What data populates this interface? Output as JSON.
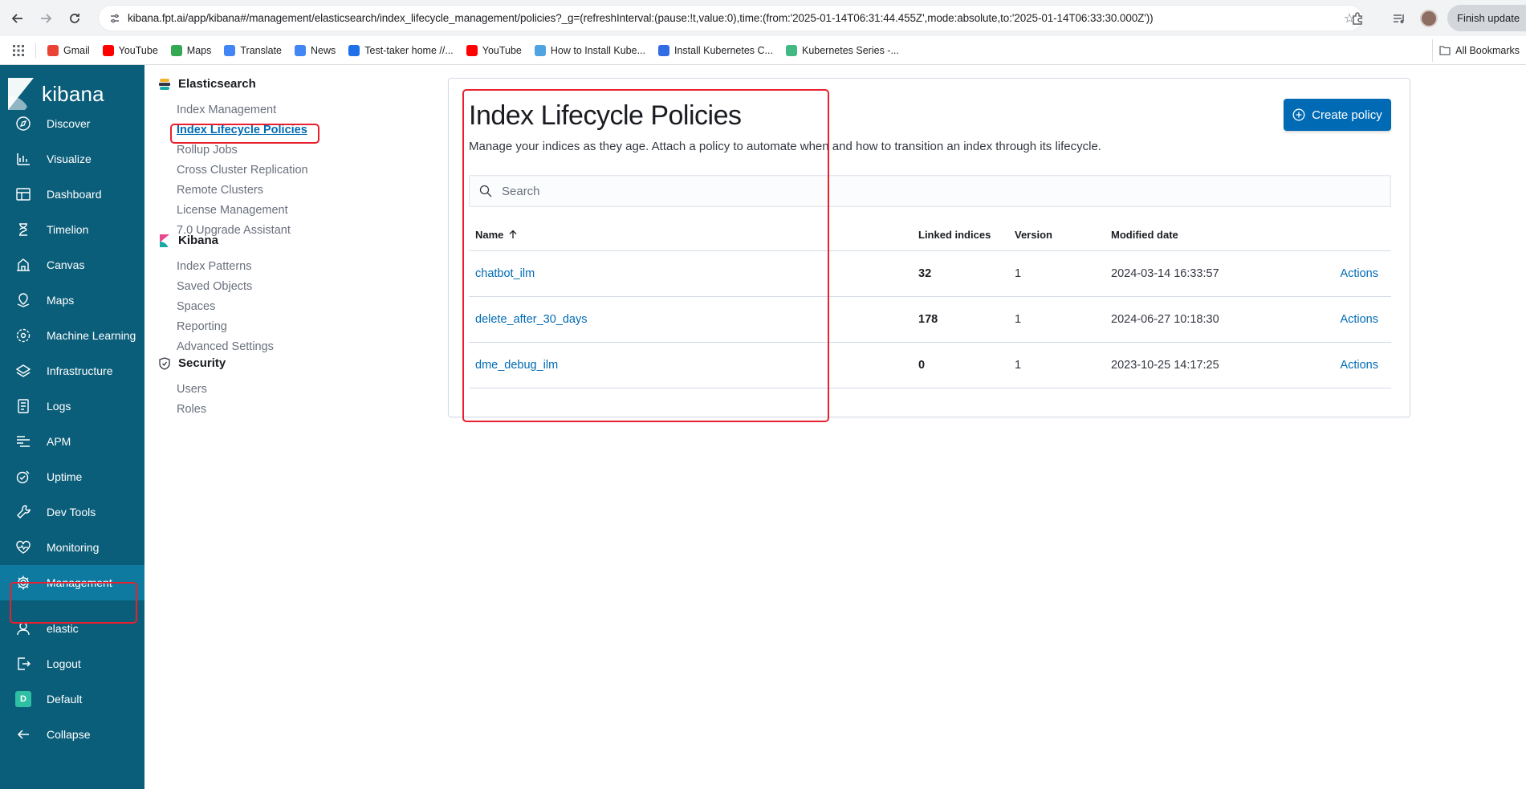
{
  "browser": {
    "url": "kibana.fpt.ai/app/kibana#/management/elasticsearch/index_lifecycle_management/policies?_g=(refreshInterval:(pause:!t,value:0),time:(from:'2025-01-14T06:31:44.455Z',mode:absolute,to:'2025-01-14T06:33:30.000Z'))",
    "update_label": "Finish update",
    "bookmarks": [
      {
        "label": "Gmail",
        "icon": "gmail-icon",
        "color": "#ea4335"
      },
      {
        "label": "YouTube",
        "icon": "youtube-icon",
        "color": "#ff0000"
      },
      {
        "label": "Maps",
        "icon": "maps-icon",
        "color": "#34a853"
      },
      {
        "label": "Translate",
        "icon": "translate-icon",
        "color": "#4285f4"
      },
      {
        "label": "News",
        "icon": "news-icon",
        "color": "#4285f4"
      },
      {
        "label": "Test-taker home //...",
        "icon": "test-taker-icon",
        "color": "#1f6feb"
      },
      {
        "label": "YouTube",
        "icon": "youtube-icon",
        "color": "#ff0000"
      },
      {
        "label": "How to Install Kube...",
        "icon": "cloud-icon",
        "color": "#4fa3e0"
      },
      {
        "label": "Install Kubernetes C...",
        "icon": "kubernetes-icon",
        "color": "#326ce5"
      },
      {
        "label": "Kubernetes Series -...",
        "icon": "vue-icon",
        "color": "#42b883"
      }
    ],
    "all_bookmarks_label": "All Bookmarks"
  },
  "kibana_nav": {
    "brand": "kibana",
    "items": [
      {
        "label": "Discover",
        "icon": "compass-icon"
      },
      {
        "label": "Visualize",
        "icon": "visualize-icon"
      },
      {
        "label": "Dashboard",
        "icon": "dashboard-icon"
      },
      {
        "label": "Timelion",
        "icon": "timelion-icon"
      },
      {
        "label": "Canvas",
        "icon": "canvas-icon"
      },
      {
        "label": "Maps",
        "icon": "maps-icon"
      },
      {
        "label": "Machine Learning",
        "icon": "machine-learning-icon"
      },
      {
        "label": "Infrastructure",
        "icon": "infrastructure-icon"
      },
      {
        "label": "Logs",
        "icon": "logs-icon"
      },
      {
        "label": "APM",
        "icon": "apm-icon"
      },
      {
        "label": "Uptime",
        "icon": "uptime-icon"
      },
      {
        "label": "Dev Tools",
        "icon": "wrench-icon"
      },
      {
        "label": "Monitoring",
        "icon": "monitoring-icon"
      },
      {
        "label": "Management",
        "icon": "gear-icon"
      }
    ],
    "active": "Management",
    "bottom": [
      {
        "label": "elastic",
        "icon": "user-icon"
      },
      {
        "label": "Logout",
        "icon": "logout-icon"
      },
      {
        "label": "Default",
        "icon": "space-avatar",
        "avatar_letter": "D"
      },
      {
        "label": "Collapse",
        "icon": "collapse-arrow-icon"
      }
    ]
  },
  "mgmt_nav": {
    "sections": [
      {
        "title": "Elasticsearch",
        "icon": "elasticsearch-icon",
        "links": [
          "Index Management",
          "Index Lifecycle Policies",
          "Rollup Jobs",
          "Cross Cluster Replication",
          "Remote Clusters",
          "License Management",
          "7.0 Upgrade Assistant"
        ]
      },
      {
        "title": "Kibana",
        "icon": "kibana-icon",
        "links": [
          "Index Patterns",
          "Saved Objects",
          "Spaces",
          "Reporting",
          "Advanced Settings"
        ]
      },
      {
        "title": "Security",
        "icon": "shield-icon",
        "links": [
          "Users",
          "Roles"
        ]
      }
    ],
    "selected": "Index Lifecycle Policies"
  },
  "main": {
    "title": "Index Lifecycle Policies",
    "description": "Manage your indices as they age. Attach a policy to automate when and how to transition an index through its lifecycle.",
    "create_button": "Create policy",
    "search_placeholder": "Search",
    "columns": {
      "name": "Name",
      "linked": "Linked indices",
      "version": "Version",
      "modified": "Modified date"
    },
    "sort_icon": "sort-ascending-icon",
    "rows": [
      {
        "name": "chatbot_ilm",
        "linked": "32",
        "version": "1",
        "modified": "2024-03-14 16:33:57",
        "action": "Actions"
      },
      {
        "name": "delete_after_30_days",
        "linked": "178",
        "version": "1",
        "modified": "2024-06-27 10:18:30",
        "action": "Actions"
      },
      {
        "name": "dme_debug_ilm",
        "linked": "0",
        "version": "1",
        "modified": "2023-10-25 14:17:25",
        "action": "Actions"
      }
    ]
  },
  "colors": {
    "nav_bg": "#0b5e7a",
    "nav_active": "#0f7aa0",
    "primary": "#006bb4",
    "annotation": "#e8202e"
  }
}
